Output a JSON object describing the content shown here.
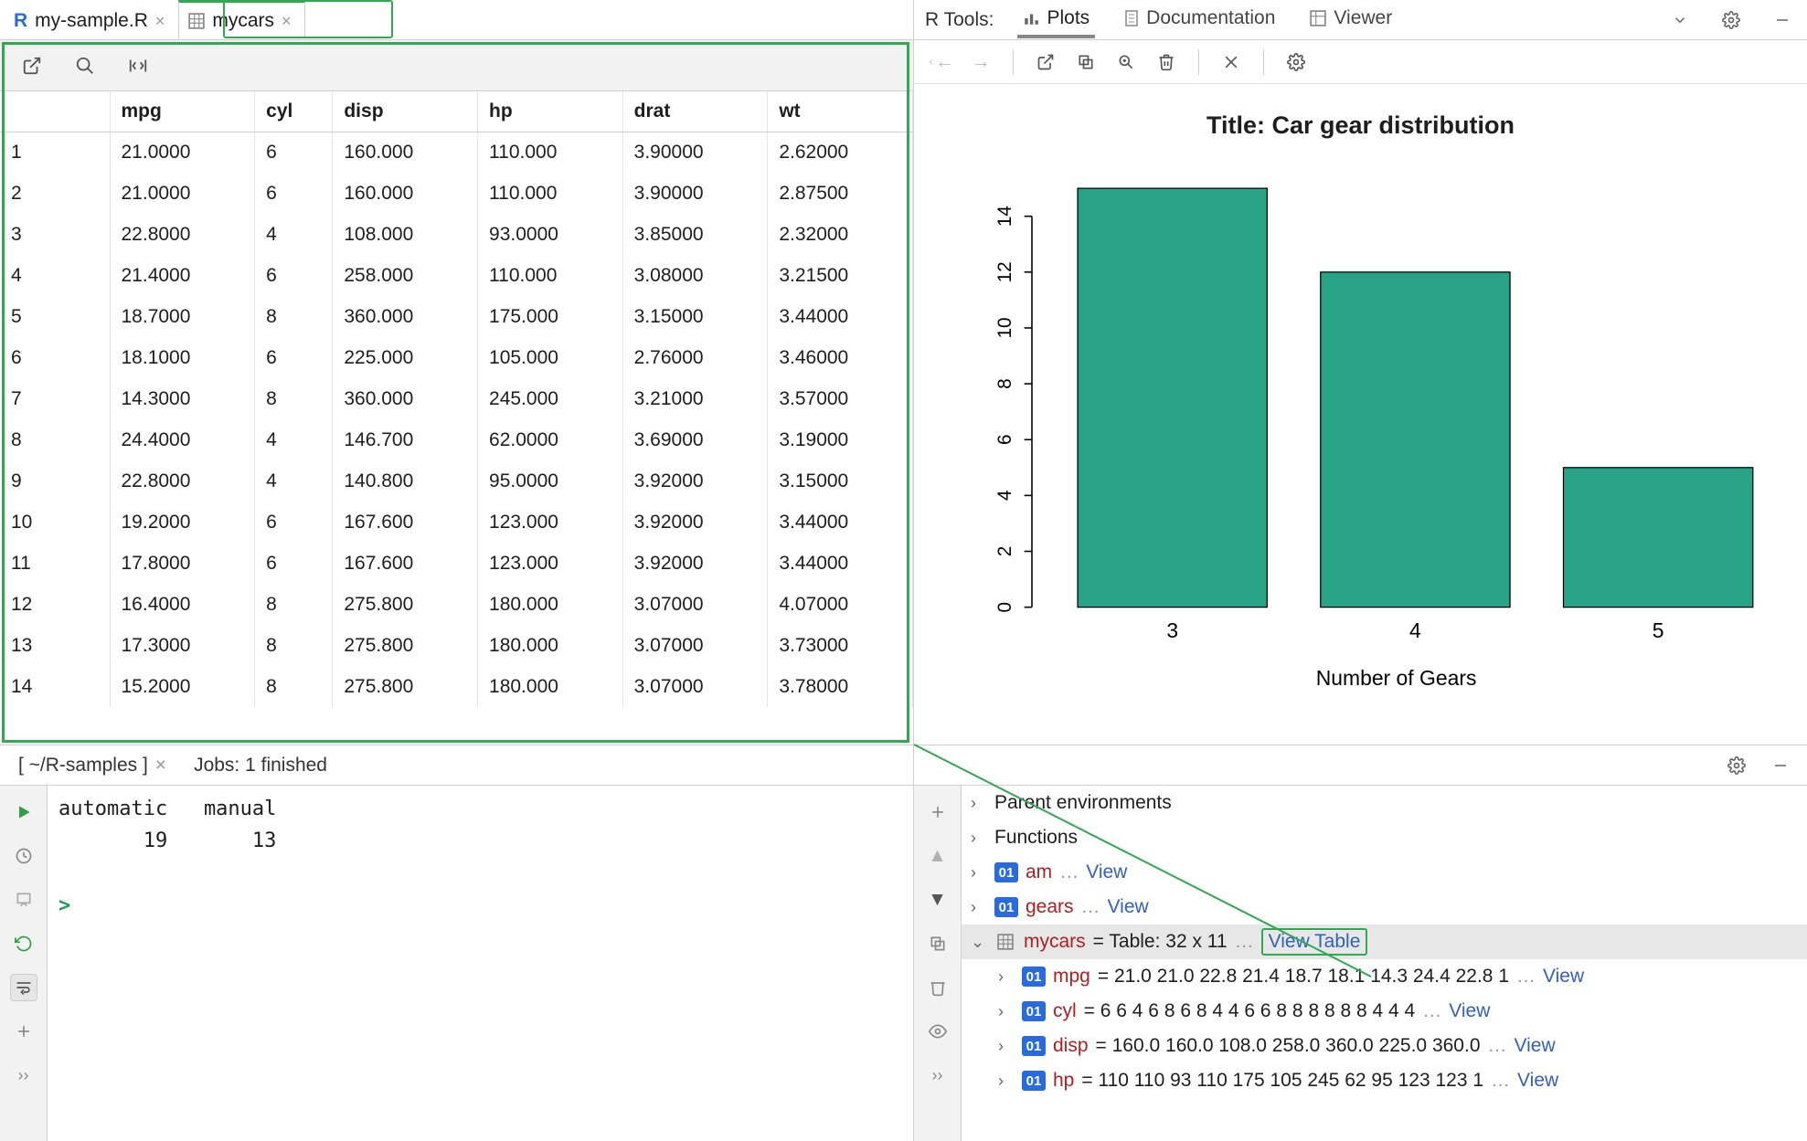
{
  "tabs": {
    "editor": [
      {
        "label": "my-sample.R",
        "icon": "r-file-icon",
        "active": false
      },
      {
        "label": "mycars",
        "icon": "table-icon",
        "active": true
      }
    ]
  },
  "data_table": {
    "columns": [
      "",
      "mpg",
      "cyl",
      "disp",
      "hp",
      "drat",
      "wt"
    ],
    "rows": [
      [
        "1",
        "21.0000",
        "6",
        "160.000",
        "110.000",
        "3.90000",
        "2.62000"
      ],
      [
        "2",
        "21.0000",
        "6",
        "160.000",
        "110.000",
        "3.90000",
        "2.87500"
      ],
      [
        "3",
        "22.8000",
        "4",
        "108.000",
        "93.0000",
        "3.85000",
        "2.32000"
      ],
      [
        "4",
        "21.4000",
        "6",
        "258.000",
        "110.000",
        "3.08000",
        "3.21500"
      ],
      [
        "5",
        "18.7000",
        "8",
        "360.000",
        "175.000",
        "3.15000",
        "3.44000"
      ],
      [
        "6",
        "18.1000",
        "6",
        "225.000",
        "105.000",
        "2.76000",
        "3.46000"
      ],
      [
        "7",
        "14.3000",
        "8",
        "360.000",
        "245.000",
        "3.21000",
        "3.57000"
      ],
      [
        "8",
        "24.4000",
        "4",
        "146.700",
        "62.0000",
        "3.69000",
        "3.19000"
      ],
      [
        "9",
        "22.8000",
        "4",
        "140.800",
        "95.0000",
        "3.92000",
        "3.15000"
      ],
      [
        "10",
        "19.2000",
        "6",
        "167.600",
        "123.000",
        "3.92000",
        "3.44000"
      ],
      [
        "11",
        "17.8000",
        "6",
        "167.600",
        "123.000",
        "3.92000",
        "3.44000"
      ],
      [
        "12",
        "16.4000",
        "8",
        "275.800",
        "180.000",
        "3.07000",
        "4.07000"
      ],
      [
        "13",
        "17.3000",
        "8",
        "275.800",
        "180.000",
        "3.07000",
        "3.73000"
      ],
      [
        "14",
        "15.2000",
        "8",
        "275.800",
        "180.000",
        "3.07000",
        "3.78000"
      ]
    ]
  },
  "rtools": {
    "label": "R Tools:",
    "tabs": {
      "plots": "Plots",
      "docs": "Documentation",
      "viewer": "Viewer"
    }
  },
  "chart_data": {
    "type": "bar",
    "title": "Title: Car gear distribution",
    "xlabel": "Number of Gears",
    "ylabel": "",
    "categories": [
      "3",
      "4",
      "5"
    ],
    "values": [
      15,
      12,
      5
    ],
    "yticks": [
      0,
      2,
      4,
      6,
      8,
      10,
      12,
      14
    ],
    "ylim": [
      0,
      15
    ],
    "bar_color": "#29a386"
  },
  "console": {
    "path_tab": "[ ~/R-samples ]",
    "jobs_tab": "Jobs: 1 finished",
    "output_header": "automatic   manual ",
    "output_values": "       19       13 ",
    "prompt": ">"
  },
  "env": {
    "nodes": {
      "parent": "Parent environments",
      "functions": "Functions",
      "am": {
        "name": "am",
        "link": "View"
      },
      "gears": {
        "name": "gears",
        "link": "View"
      },
      "mycars": {
        "name": "mycars",
        "desc": " = Table: 32 x 11",
        "link": "View Table"
      },
      "mpg": {
        "name": "mpg",
        "val": " = 21.0 21.0 22.8 21.4 18.7 18.1 14.3 24.4 22.8 1",
        "link": "View"
      },
      "cyl": {
        "name": "cyl",
        "val": " = 6 6 4 6 8 6 8 4 4 6 6 8 8 8 8 8 8 4 4 4",
        "link": "View"
      },
      "disp": {
        "name": "disp",
        "val": " = 160.0 160.0 108.0 258.0 360.0 225.0 360.0",
        "link": "View"
      },
      "hp": {
        "name": "hp",
        "val": " = 110 110  93 110 175 105 245  62  95 123 123 1",
        "link": "View"
      }
    }
  }
}
